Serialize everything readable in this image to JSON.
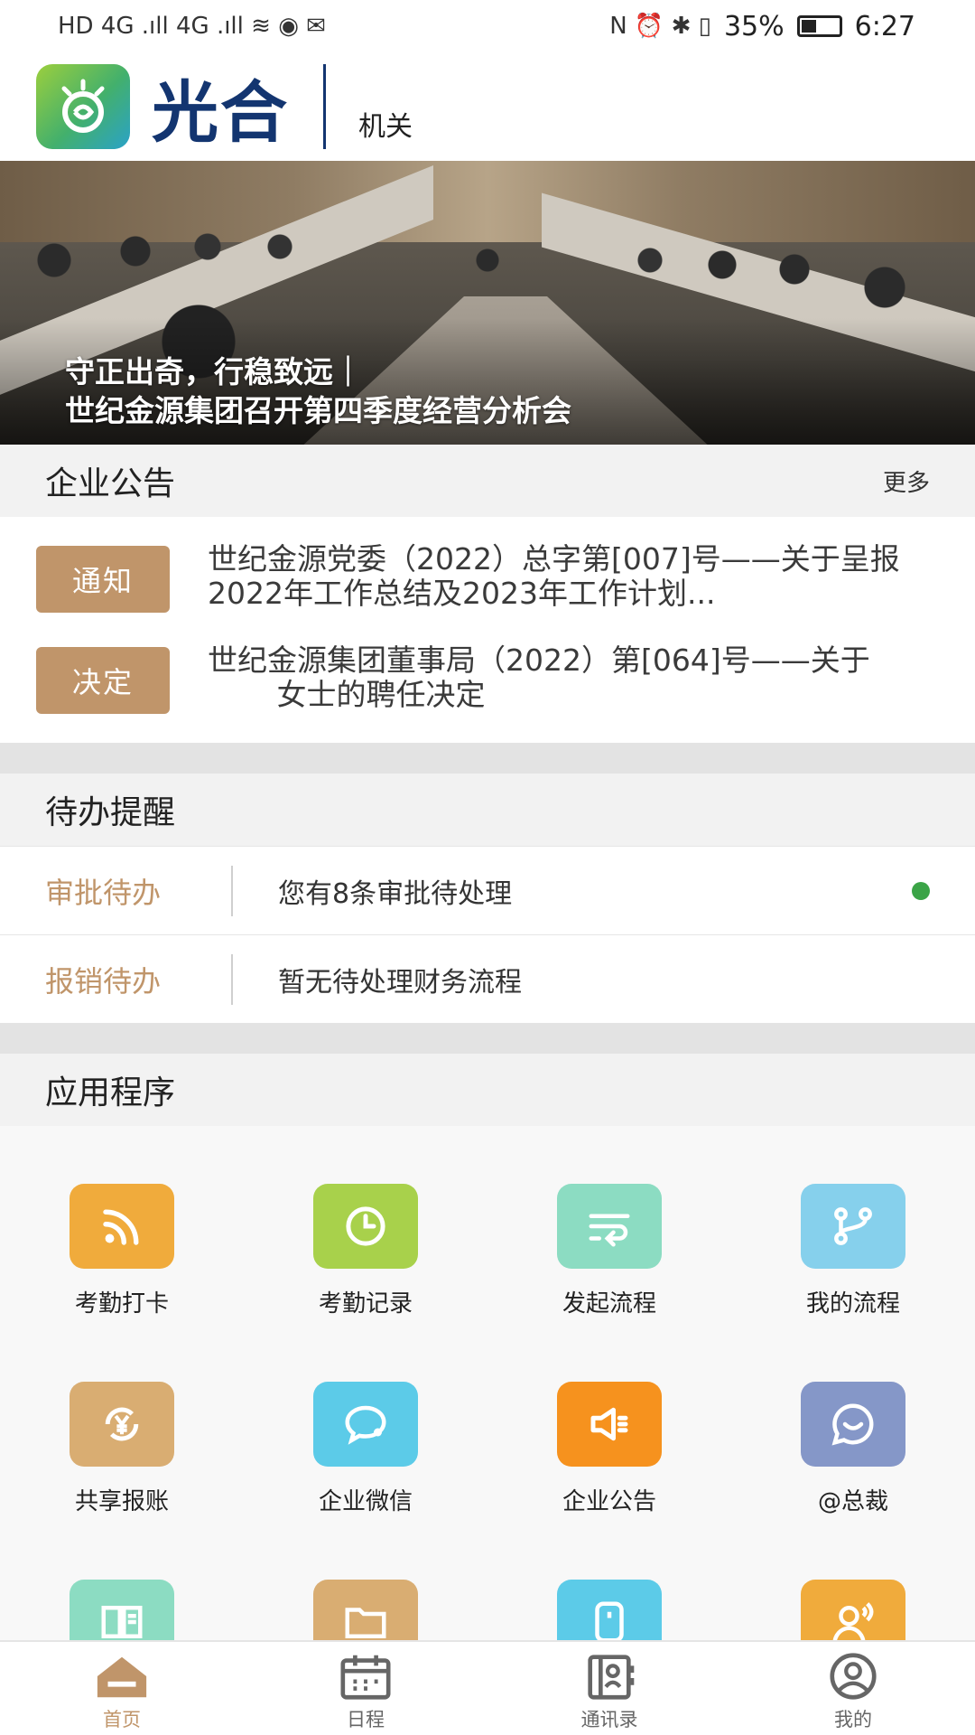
{
  "statusbar": {
    "left_icons": "HD 4G .ıll 4G .ıll  ≋ ◉ ✉",
    "right_icons": "N ⏰ ✱ ▯",
    "battery": "35%",
    "time": "6:27"
  },
  "header": {
    "logo_text": "光合",
    "org_name": "机关"
  },
  "banner": {
    "title_line1": "守正出奇，行稳致远｜",
    "title_line2": "世纪金源集团召开第四季度经营分析会"
  },
  "announcements": {
    "title": "企业公告",
    "more": "更多",
    "items": [
      {
        "tag": "通知",
        "text": "世纪金源党委（2022）总字第[007]号——关于呈报2022年工作总结及2023年工作计划..."
      },
      {
        "tag": "决定",
        "text": "世纪金源集团董事局（2022）第[064]号——关于 　　 女士的聘任决定"
      }
    ]
  },
  "todo": {
    "title": "待办提醒",
    "rows": [
      {
        "label": "审批待办",
        "text": "您有8条审批待处理",
        "dot": true
      },
      {
        "label": "报销待办",
        "text": "暂无待处理财务流程",
        "dot": false
      }
    ]
  },
  "apps": {
    "title": "应用程序",
    "items": [
      {
        "label": "考勤打卡",
        "icon": "rss-icon",
        "color": "#f0ab3c"
      },
      {
        "label": "考勤记录",
        "icon": "clock-icon",
        "color": "#a8d14b"
      },
      {
        "label": "发起流程",
        "icon": "flow-icon",
        "color": "#8cdcc2"
      },
      {
        "label": "我的流程",
        "icon": "branch-icon",
        "color": "#86d0ec"
      },
      {
        "label": "共享报账",
        "icon": "yen-refresh-icon",
        "color": "#d9ad72"
      },
      {
        "label": "企业微信",
        "icon": "chat-icon",
        "color": "#5ccbe8"
      },
      {
        "label": "企业公告",
        "icon": "megaphone-icon",
        "color": "#f6921e"
      },
      {
        "label": "@总裁",
        "icon": "message-icon",
        "color": "#8597c8"
      },
      {
        "label": "",
        "icon": "book-icon",
        "color": "#8cdcc2"
      },
      {
        "label": "",
        "icon": "folder-icon",
        "color": "#d9ad72"
      },
      {
        "label": "",
        "icon": "device-icon",
        "color": "#5ccbe8"
      },
      {
        "label": "",
        "icon": "voice-icon",
        "color": "#f0ab3c"
      }
    ]
  },
  "tabbar": {
    "items": [
      {
        "label": "首页",
        "icon": "home-icon"
      },
      {
        "label": "日程",
        "icon": "calendar-icon"
      },
      {
        "label": "通讯录",
        "icon": "contacts-icon"
      },
      {
        "label": "我的",
        "icon": "profile-icon"
      }
    ]
  }
}
